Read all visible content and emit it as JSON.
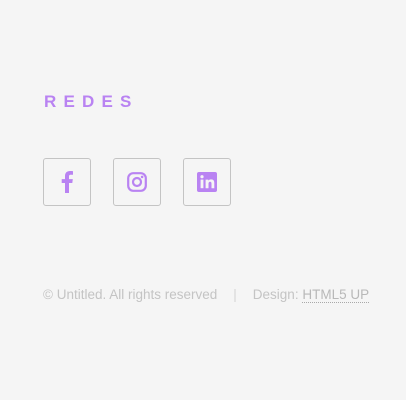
{
  "footer": {
    "title": "REDES",
    "social": [
      {
        "name": "Facebook",
        "icon": "facebook-icon"
      },
      {
        "name": "Instagram",
        "icon": "instagram-icon"
      },
      {
        "name": "LinkedIn",
        "icon": "linkedin-icon"
      }
    ],
    "copyright": {
      "text": "© Untitled. All rights reserved",
      "separator": "|",
      "design_label": "Design: ",
      "design_link": "HTML5 UP"
    }
  },
  "colors": {
    "accent": "#b983f2",
    "background": "#f5f5f5",
    "border": "#c4c4c4",
    "muted_text": "#c4c4c4"
  }
}
